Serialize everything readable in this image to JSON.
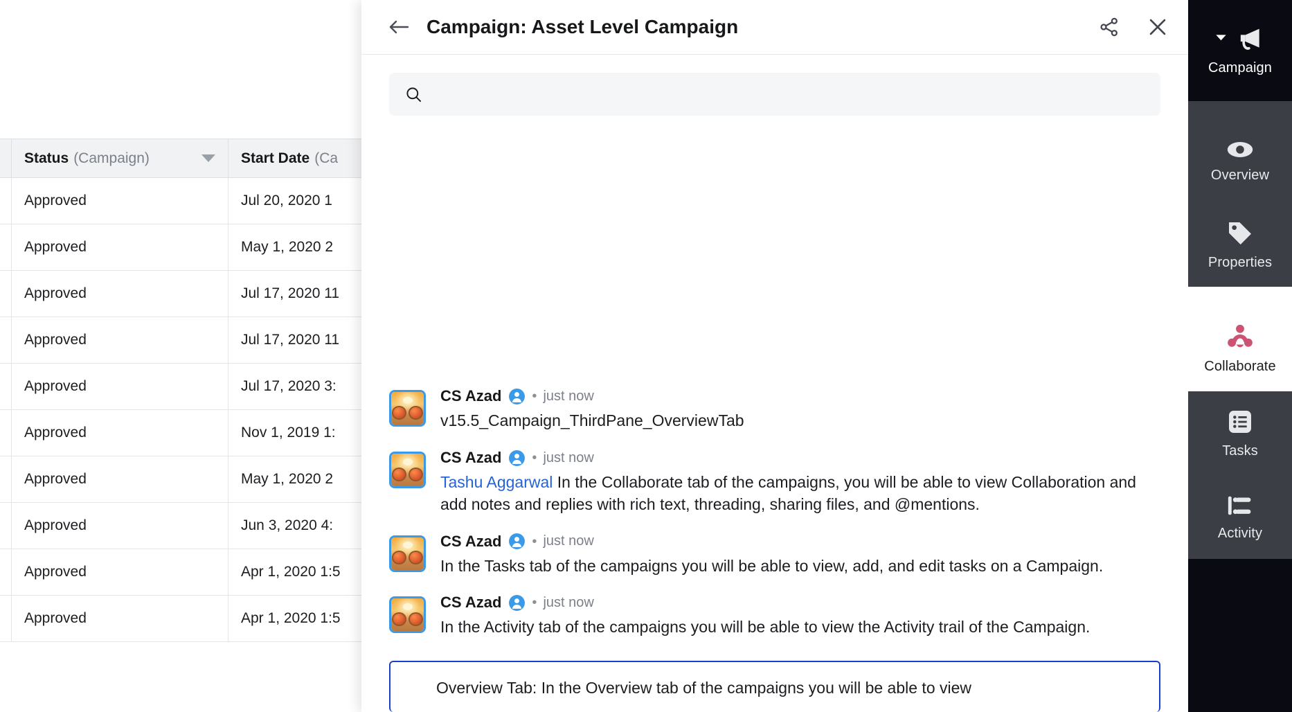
{
  "table": {
    "columns": [
      {
        "name": "Status",
        "qualifier": "(Campaign)",
        "sortable": true
      },
      {
        "name": "Start Date",
        "qualifier": "(Ca",
        "sortable": false
      }
    ],
    "rows": [
      {
        "status": "Approved",
        "start_date": "Jul 20, 2020 1"
      },
      {
        "status": "Approved",
        "start_date": "May 1, 2020 2"
      },
      {
        "status": "Approved",
        "start_date": "Jul 17, 2020 11"
      },
      {
        "status": "Approved",
        "start_date": "Jul 17, 2020 11"
      },
      {
        "status": "Approved",
        "start_date": "Jul 17, 2020 3:"
      },
      {
        "status": "Approved",
        "start_date": "Nov 1, 2019 1:"
      },
      {
        "status": "Approved",
        "start_date": "May 1, 2020 2"
      },
      {
        "status": "Approved",
        "start_date": "Jun 3, 2020 4:"
      },
      {
        "status": "Approved",
        "start_date": "Apr 1, 2020 1:5"
      },
      {
        "status": "Approved",
        "start_date": "Apr 1, 2020 1:5"
      }
    ]
  },
  "panel": {
    "back_icon": "arrow-left-icon",
    "title": "Campaign: Asset Level Campaign",
    "share_icon": "share-icon",
    "close_icon": "close-icon",
    "search": {
      "icon": "search-icon",
      "value": "",
      "placeholder": ""
    },
    "comments": [
      {
        "author": "CS Azad",
        "badge_icon": "user-badge-icon",
        "separator": "•",
        "time": "just now",
        "mention": "",
        "text": "v15.5_Campaign_ThirdPane_OverviewTab"
      },
      {
        "author": "CS Azad",
        "badge_icon": "user-badge-icon",
        "separator": "•",
        "time": "just now",
        "mention": "Tashu Aggarwal",
        "text": " In the Collaborate tab of the campaigns, you will be able to view Collaboration and add notes and replies with rich text, threading, sharing files, and @mentions."
      },
      {
        "author": "CS Azad",
        "badge_icon": "user-badge-icon",
        "separator": "•",
        "time": "just now",
        "mention": "",
        "text": "In the Tasks tab of the campaigns you will be able to view, add, and edit tasks on a Campaign."
      },
      {
        "author": "CS Azad",
        "badge_icon": "user-badge-icon",
        "separator": "•",
        "time": "just now",
        "mention": "",
        "text": "In the Activity tab of the campaigns you will be able to view the Activity trail of the Campaign."
      }
    ],
    "composer": {
      "value": "Overview Tab: In the Overview tab of the campaigns you will be able to view",
      "placeholder": "",
      "focus_color": "#1b3fcc"
    }
  },
  "rail": {
    "items": [
      {
        "label": "Campaign",
        "icon": "megaphone-icon",
        "active": false,
        "expanded": true,
        "style": "header"
      },
      {
        "label": "Overview",
        "icon": "eye-icon",
        "active": false,
        "style": "dark"
      },
      {
        "label": "Properties",
        "icon": "tag-icon",
        "active": false,
        "style": "dark"
      },
      {
        "label": "Collaborate",
        "icon": "collaborate-icon",
        "active": true,
        "style": "light"
      },
      {
        "label": "Tasks",
        "icon": "task-list-icon",
        "active": false,
        "style": "dark"
      },
      {
        "label": "Activity",
        "icon": "activity-trail-icon",
        "active": false,
        "style": "dark"
      }
    ],
    "colors": {
      "header_bg": "#0a0b12",
      "dark_bg": "#3b3f45",
      "active_bg": "#ffffff",
      "collaborate_accent": "#cc5472"
    }
  }
}
